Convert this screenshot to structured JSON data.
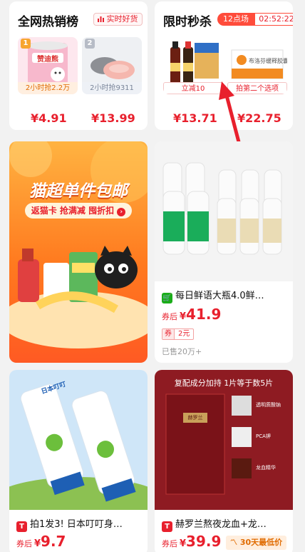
{
  "hot_list": {
    "title": "全网热销榜",
    "tag": "实时好货",
    "items": [
      {
        "rank": "1",
        "caption": "2小时抢2.2万",
        "price": "¥4.91",
        "thumb_label": "赞迪熊"
      },
      {
        "rank": "2",
        "caption": "2小时抢9311",
        "price": "¥13.99"
      }
    ]
  },
  "flash_sale": {
    "title": "限时秒杀",
    "round": "12点场",
    "timer": "02:52:22",
    "items": [
      {
        "caption": "立减10",
        "price": "¥13.71"
      },
      {
        "caption": "拍第二个选项",
        "price": "¥22.75",
        "thumb_label": "布洛芬缓释胶囊"
      }
    ]
  },
  "promo": {
    "title": "猫超单件包邮",
    "subtitle": "返猫卡 抢满减 囤折扣"
  },
  "products": [
    {
      "title": "每日鲜语大瓶4.0鲜…",
      "price_prefix": "券后",
      "currency": "¥",
      "price": "41.9",
      "coupon_label": "券",
      "coupon_value": "2元",
      "sold": "已售20万+"
    },
    {
      "title": "拍1发3! 日本叮叮身…",
      "price_prefix": "券后",
      "currency": "¥",
      "price": "9.7",
      "image_label": "日本叮叮"
    },
    {
      "title": "赫罗兰熬夜龙血+龙…",
      "price_prefix": "券后",
      "currency": "¥",
      "price": "39.9",
      "low_tag": "30天最低价",
      "banner": "复配成分加持 1片等于数5片",
      "image_labels": [
        "透明质酸钠",
        "PCA钾",
        "龙血精华"
      ],
      "brand": "赫罗兰"
    }
  ],
  "colors": {
    "accent": "#e8202d",
    "orange": "#ff7a1f",
    "tmall_green": "#1aad19"
  }
}
